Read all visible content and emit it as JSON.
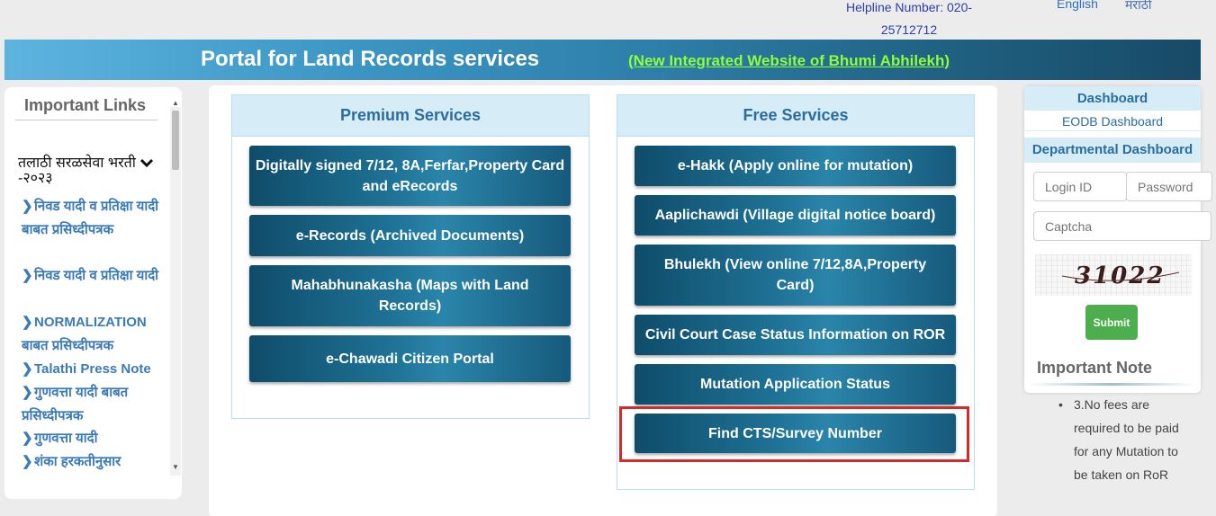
{
  "topbar": {
    "helpline": "Helpline Number: 020-25712712",
    "lang_english": "English",
    "lang_marathi": "मराठी"
  },
  "banner": {
    "title": "Portal for Land Records services",
    "link": "(New Integrated Website of Bhumi Abhilekh)"
  },
  "important_links": {
    "title": "Important Links",
    "section": "तलाठी सरळसेवा भरती -२०२३",
    "items": [
      "निवड यादी व प्रतिक्षा यादी बाबत प्रसिध्दीपत्रक",
      "निवड यादी व प्रतिक्षा यादी",
      "NORMALIZATION बाबत प्रसिध्दीपत्रक",
      "Talathi Press Note",
      "गुणवत्ता यादी बाबत प्रसिध्दीपत्रक",
      "गुणवत्ता यादी",
      "शंका हरकतीनुसार"
    ]
  },
  "premium": {
    "title": "Premium Services",
    "buttons": [
      "Digitally signed 7/12, 8A,Ferfar,Property Card and eRecords",
      "e-Records (Archived Documents)",
      "Mahabhunakasha (Maps with Land Records)",
      "e-Chawadi Citizen Portal"
    ]
  },
  "free": {
    "title": "Free Services",
    "buttons": [
      "e-Hakk (Apply online for mutation)",
      "Aaplichawdi (Village digital notice board)",
      "Bhulekh (View online 7/12,8A,Property Card)",
      "Civil Court Case Status Information on ROR",
      "Mutation Application Status",
      "Find CTS/Survey Number"
    ]
  },
  "dashboard": {
    "title": "Dashboard",
    "eodb": "EODB Dashboard",
    "departmental": "Departmental Dashboard",
    "login_placeholder": "Login ID",
    "password_placeholder": "Password",
    "captcha_placeholder": "Captcha",
    "captcha_text": "31022",
    "submit": "Submit"
  },
  "important_note": {
    "title": "Important Note",
    "text": "3.No fees are required to be paid for any Mutation to be taken on RoR"
  },
  "colors": {
    "banner_start": "#5db4df",
    "banner_end": "#174a66",
    "link_green": "#8cff3a",
    "highlight_red": "#d52a2a",
    "submit_green": "#4cae4c"
  }
}
